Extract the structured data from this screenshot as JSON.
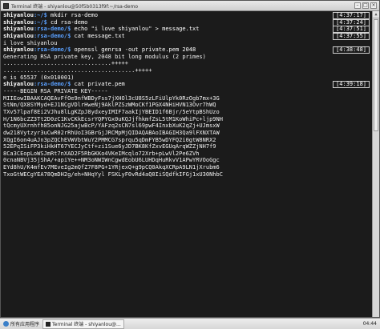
{
  "window": {
    "title": "Terminal 终端 - shiyanlou@50f5b0313f9f:~/rsa-demo",
    "buttons": [
      "–",
      "□",
      "×"
    ]
  },
  "terminal": {
    "lines": [
      {
        "type": "prompt",
        "user": "shiyanlou",
        "path": ":~/",
        "sym": "$ ",
        "cmd": "mkdir rsa-demo",
        "time": "[4:37:17]"
      },
      {
        "type": "prompt",
        "user": "shiyanlou",
        "path": ":~/",
        "sym": "$ ",
        "cmd": "cd rsa-demo",
        "time": "[4:37:24]"
      },
      {
        "type": "prompt",
        "user": "shiyanlou",
        "path": ":rsa-demo/",
        "sym": "$ ",
        "cmd": "echo \"i love shiyanlou\" > message.txt",
        "time": "[4:37:51]"
      },
      {
        "type": "prompt",
        "user": "shiyanlou",
        "path": ":rsa-demo/",
        "sym": "$ ",
        "cmd": "cat message.txt",
        "time": "[4:37:55]"
      },
      {
        "type": "text",
        "text": "i love shiyanlou"
      },
      {
        "type": "prompt",
        "user": "shiyanlou",
        "path": ":rsa-demo/",
        "sym": "$ ",
        "cmd": "openssl genrsa -out private.pem 2048",
        "time": "[4:38:48]"
      },
      {
        "type": "text",
        "text": "Generating RSA private key, 2048 bit long modulus (2 primes)"
      },
      {
        "type": "text",
        "text": "................................+++++"
      },
      {
        "type": "text",
        "text": ".......................................+++++"
      },
      {
        "type": "text",
        "text": "e is 65537 (0x010001)"
      },
      {
        "type": "prompt",
        "user": "shiyanlou",
        "path": ":rsa-demo/",
        "sym": "$ ",
        "cmd": "cat private.pem",
        "time": "[4:39:18]"
      },
      {
        "type": "text",
        "text": "-----BEGIN RSA PRIVATE KEY-----"
      },
      {
        "type": "text",
        "text": "MIIEowIBAAKCAQEAvFfOe9nfWBDyFss7jXHOl3cU8S5zLFiUlpYk0RzOgb7mx+3G"
      },
      {
        "type": "text",
        "text": "StNm/QX8SYMyd+EJ1NCgVDlrHweNj9AklPZSzWMoCKf1PGX4NHiHVN13Ovr7hWQ"
      },
      {
        "type": "text",
        "text": "TXv57lpaf8Ei2VJhu8lLgKZpJ8ydxeyIMIF7aakIjYBEID1f6Bjr/5eYtpBShUzo"
      },
      {
        "type": "text",
        "text": "H/1N6bcZZ3Tt2D0zC1KvCKkEcsrYQPYGx0uKQJjfhkmfZsL5tM1KoWhiPc+ljp9NH"
      },
      {
        "type": "text",
        "text": "tQcmyUXrnhfh85onNJG25ajwBcP/YAFzq2sCN7sl69pwF4InxbXuK2qZj+UJmsxW"
      },
      {
        "type": "text",
        "text": "dw218Vytzyr3uCwR02rRhUoI3GBrGjJRCMpMjQIDAQABAoIBAGIH3Qa9lFXNXTAW"
      },
      {
        "type": "text",
        "text": "XQgI6on4uAJn3pZQChEVWVbtWuY2PMMCG7sprqu5qDmFYB5wDYFQ2i0gtW8NRX2"
      },
      {
        "type": "text",
        "text": "52EPqISiFP3kiHkHT67YECJyCtf+zi1Sue6yJD7BK8KfZxvEGUqArqWZZjNH7f9"
      },
      {
        "type": "text",
        "text": "8Ca3CEopLoWSJmRt7nXAD2F5RbGKKo4VKeIMcqlo72Xrb+pLwVl2Pe6ZVh"
      },
      {
        "type": "text",
        "text": "0cnaNBVj35jShA/+apiYe++NM3oNWIWnCgwdEobU6LUHDqHuRkvV1APwYRVOoGgc"
      },
      {
        "type": "text",
        "text": "EYd8hU/K4mfEv7MEveIg2mQfZ7F8PG+1YRjexQ+g9pCQ0AkqXCRpA9LN1jXrubm6"
      },
      {
        "type": "text",
        "text": "TxoGtWECgYEA78QmDH2g/eh+NHqYyl FSKLyF0vRd4aQ0IiSQdfkIFGj1xU30NhbC"
      }
    ]
  },
  "taskbar": {
    "start_label": "所有应用程序",
    "task_label": "Terminal 终端 - shiyanlou@...",
    "clock": "04:44"
  }
}
